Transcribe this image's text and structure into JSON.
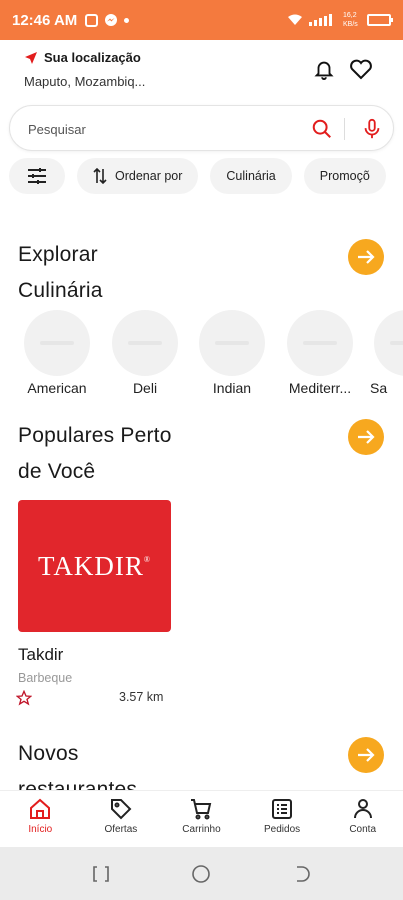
{
  "status_bar": {
    "time": "12:46 AM",
    "right_text": "16,2 KB/s"
  },
  "header": {
    "location_title": "Sua localização",
    "location_value": "Maputo, Mozambiq..."
  },
  "search": {
    "placeholder": "Pesquisar"
  },
  "filters": [
    {
      "label": ""
    },
    {
      "label": "Ordenar por"
    },
    {
      "label": "Culinária"
    },
    {
      "label": "Promoçõ"
    }
  ],
  "explore": {
    "title_line1": "Explorar",
    "title_line2": "Culinária",
    "cuisines": [
      "American",
      "Deli",
      "Indian",
      "Mediterr...",
      "Sa"
    ]
  },
  "popular": {
    "title_line1": "Populares Perto",
    "title_line2": "de Você",
    "restaurants": [
      {
        "logo_text": "TAKDIR",
        "name": "Takdir",
        "category": "Barbeque",
        "distance": "3.57 km"
      }
    ]
  },
  "new_restaurants": {
    "title_line1": "Novos",
    "title_line2": "restaurantes"
  },
  "bottom_nav": [
    {
      "label": "Início",
      "active": true
    },
    {
      "label": "Ofertas"
    },
    {
      "label": "Carrinho"
    },
    {
      "label": "Pedidos"
    },
    {
      "label": "Conta"
    }
  ],
  "colors": {
    "status_bar": "#f47a3e",
    "accent_red": "#e21d1d",
    "arrow_button": "#f7a81f",
    "logo_bg": "#e1262c"
  }
}
